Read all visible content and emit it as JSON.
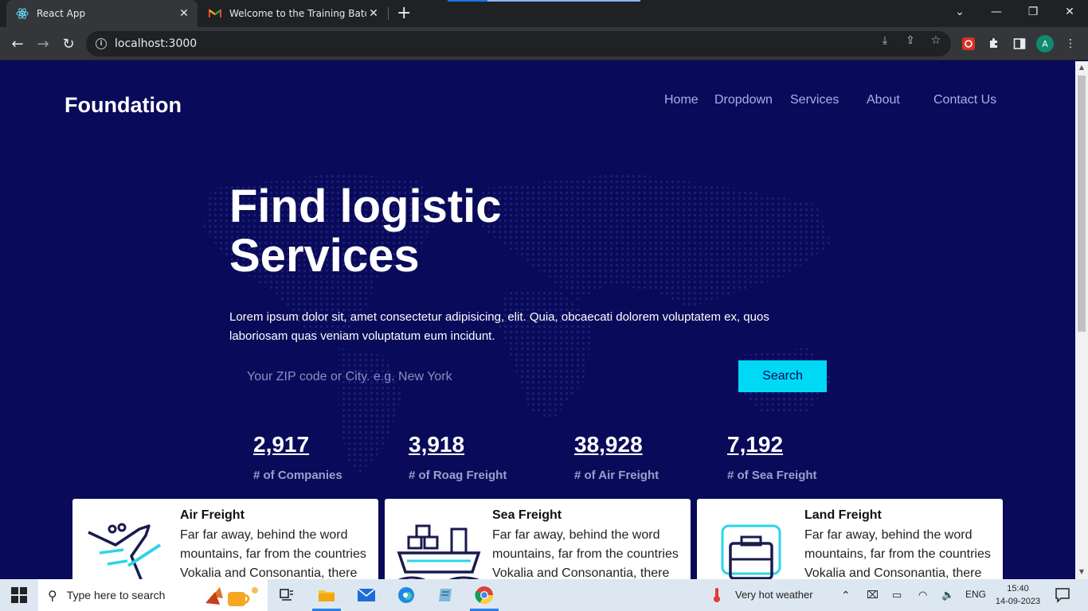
{
  "browser": {
    "tabs": [
      {
        "title": "React App",
        "active": true
      },
      {
        "title": "Welcome to the Training Batch (A",
        "active": false
      }
    ],
    "url": "localhost:3000",
    "profile_initial": "A"
  },
  "site": {
    "brand": "Foundation",
    "nav": [
      "Home",
      "Dropdown",
      "Services",
      "About",
      "Contact Us"
    ],
    "hero": {
      "title_line1": "Find logistic",
      "title_line2": "Services",
      "description": "Lorem ipsum dolor sit, amet consectetur adipisicing, elit. Quia, obcaecati dolorem voluptatem ex, quos laboriosam quas veniam voluptatum eum incidunt."
    },
    "search": {
      "placeholder": "Your ZIP code or City. e.g. New York",
      "button": "Search"
    },
    "stats": [
      {
        "value": "2,917",
        "label": "# of Companies"
      },
      {
        "value": "3,918",
        "label": "# of Roag Freight"
      },
      {
        "value": "38,928",
        "label": "# of Air Freight"
      },
      {
        "value": "7,192",
        "label": "# of Sea Freight"
      }
    ],
    "cards": [
      {
        "title": "Air Freight",
        "text": "Far far away, behind the word mountains, far from the countries Vokalia and Consonantia, there",
        "icon": "airplane-icon"
      },
      {
        "title": "Sea Freight",
        "text": "Far far away, behind the word mountains, far from the countries Vokalia and Consonantia, there",
        "icon": "ship-icon"
      },
      {
        "title": "Land Freight",
        "text": "Far far away, behind the word mountains, far from the countries Vokalia and Consonantia, there",
        "icon": "truck-icon"
      }
    ],
    "colors": {
      "background": "#0a0a5a",
      "accent": "#00d9f5",
      "card": "#ffffff"
    }
  },
  "taskbar": {
    "search_placeholder": "Type here to search",
    "weather": "Very hot weather",
    "language": "ENG",
    "time": "15:40",
    "date": "14-09-2023"
  }
}
